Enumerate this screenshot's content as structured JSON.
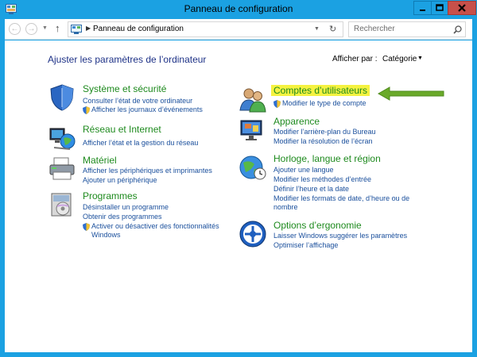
{
  "window": {
    "title": "Panneau de configuration"
  },
  "address": {
    "path": "Panneau de configuration",
    "search_placeholder": "Rechercher"
  },
  "content": {
    "heading": "Ajuster les paramètres de l’ordinateur",
    "view_by_label": "Afficher par :",
    "view_by_value": "Catégorie"
  },
  "categories": {
    "system": {
      "title": "Système et sécurité",
      "links": [
        "Consulter l’état de votre ordinateur",
        "Afficher les journaux d’événements"
      ]
    },
    "network": {
      "title": "Réseau et Internet",
      "links": [
        "Afficher l’état et la gestion du réseau"
      ]
    },
    "hardware": {
      "title": "Matériel",
      "links": [
        "Afficher les périphériques et imprimantes",
        "Ajouter un périphérique"
      ]
    },
    "programs": {
      "title": "Programmes",
      "links": [
        "Désinstaller un programme",
        "Obtenir des programmes",
        "Activer ou désactiver des fonctionnalités",
        "Windows"
      ]
    },
    "users": {
      "title": "Comptes d’utilisateurs",
      "links": [
        "Modifier le type de compte"
      ]
    },
    "appearance": {
      "title": "Apparence",
      "links": [
        "Modifier l’arrière-plan du Bureau",
        "Modifier la résolution de l’écran"
      ]
    },
    "clock": {
      "title": "Horloge, langue et région",
      "links": [
        "Ajouter une langue",
        "Modifier les méthodes d’entrée",
        "Définir l’heure et la date",
        "Modifier les formats de date, d’heure ou de",
        "nombre"
      ]
    },
    "ease": {
      "title": "Options d’ergonomie",
      "links": [
        "Laisser Windows suggérer les paramètres",
        "Optimiser l’affichage"
      ]
    }
  },
  "colors": {
    "chrome": "#1ba1e2",
    "link": "#1a4f9c",
    "category_title": "#1e8a1e",
    "heading": "#1e3287",
    "highlight": "#f5f240",
    "arrow": "#6aaa2a"
  }
}
